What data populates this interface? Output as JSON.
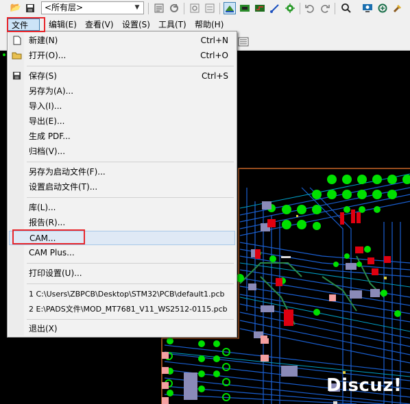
{
  "toolbar": {
    "layer_select_value": "<所有层>",
    "icons": [
      "open-folder-icon",
      "save-icon",
      "properties-icon",
      "refresh-icon",
      "redraw-icon",
      "layers-icon",
      "route-icon",
      "pcb-icon",
      "add-trace-icon",
      "via-icon",
      "undo-icon",
      "redo-icon",
      "zoom-icon",
      "display-icon",
      "cycle-icon",
      "paint-icon"
    ]
  },
  "menubar": {
    "items": [
      "文件(F)",
      "编辑(E)",
      "查看(V)",
      "设置(S)",
      "工具(T)",
      "帮助(H)"
    ]
  },
  "file_menu": {
    "items": [
      {
        "label": "新建(N)",
        "shortcut": "Ctrl+N",
        "icon": "new-file-icon"
      },
      {
        "label": "打开(O)...",
        "shortcut": "Ctrl+O",
        "icon": "open-folder-icon"
      },
      {
        "label": "保存(S)",
        "shortcut": "Ctrl+S",
        "icon": "save-icon"
      },
      {
        "label": "另存为(A)...",
        "shortcut": ""
      },
      {
        "label": "导入(I)...",
        "shortcut": ""
      },
      {
        "label": "导出(E)...",
        "shortcut": ""
      },
      {
        "label": "生成 PDF...",
        "shortcut": ""
      },
      {
        "label": "归档(V)...",
        "shortcut": ""
      },
      {
        "label": "另存为启动文件(F)...",
        "shortcut": ""
      },
      {
        "label": "设置启动文件(T)...",
        "shortcut": ""
      },
      {
        "label": "库(L)...",
        "shortcut": ""
      },
      {
        "label": "报告(R)...",
        "shortcut": ""
      },
      {
        "label": "CAM...",
        "shortcut": ""
      },
      {
        "label": "CAM Plus...",
        "shortcut": ""
      },
      {
        "label": "打印设置(U)...",
        "shortcut": ""
      },
      {
        "label": "1 C:\\Users\\ZBPCB\\Desktop\\STM32\\PCB\\default1.pcb",
        "shortcut": ""
      },
      {
        "label": "2 E:\\PADS文件\\MOD_MT7681_V11_WS2512-0115.pcb",
        "shortcut": ""
      },
      {
        "label": "退出(X)",
        "shortcut": ""
      }
    ]
  },
  "watermark": "Discuz!",
  "colors": {
    "pad_green": "#00e000",
    "trace_blue": "#1a5fd0",
    "highlight_red": "#e8262b",
    "pink_pad": "#f4a0a0",
    "board_edge": "#c86428"
  }
}
